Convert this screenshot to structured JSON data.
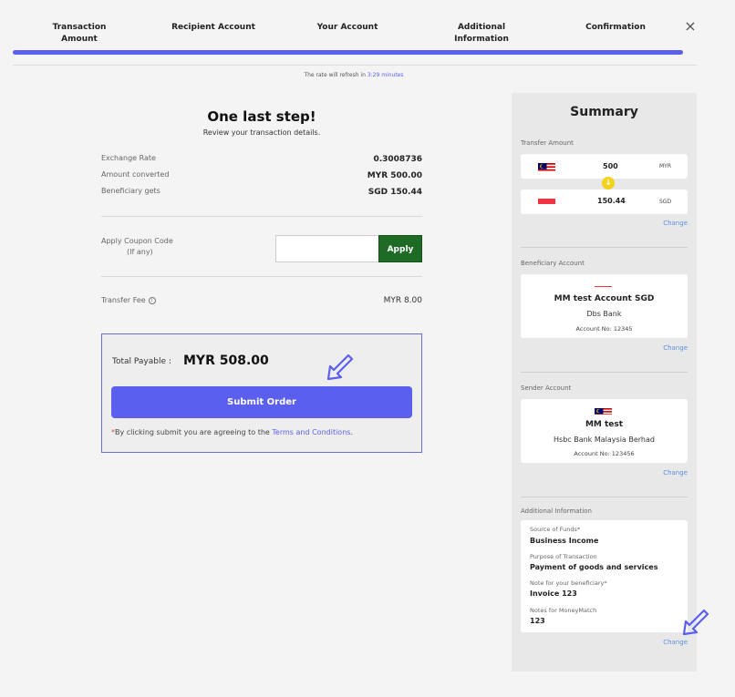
{
  "stepper": {
    "steps": [
      {
        "line1": "Transaction",
        "line2": "Amount"
      },
      {
        "line1": "Recipient Account",
        "line2": ""
      },
      {
        "line1": "Your Account",
        "line2": ""
      },
      {
        "line1": "Additional",
        "line2": "Information"
      },
      {
        "line1": "Confirmation",
        "line2": ""
      }
    ],
    "progress": 1.0,
    "close_icon": "×"
  },
  "refresh": {
    "prefix": "The rate will refresh in",
    "time": "3:29 minutes"
  },
  "main": {
    "title": "One last step!",
    "subtitle": "Review your transaction details.",
    "rows": [
      {
        "label": "Exchange Rate",
        "value": "0.3008736"
      },
      {
        "label": "Amount converted",
        "value": "MYR 500.00"
      },
      {
        "label": "Beneficiary gets",
        "value": "SGD 150.44"
      }
    ],
    "coupon": {
      "label": "Apply Coupon Code",
      "sublabel": "(If any)",
      "value": "",
      "button": "Apply"
    },
    "fee": {
      "label": "Transfer Fee",
      "icon": "info-icon",
      "value": "MYR 8.00"
    },
    "payable": {
      "label": "Total Payable :",
      "amount": "MYR 508.00"
    },
    "submit": "Submit Order",
    "terms": {
      "star": "*",
      "text": "By clicking submit you are agreeing to the",
      "link": "Terms and Conditions",
      "end": "."
    }
  },
  "summary": {
    "title": "Summary",
    "transfer": {
      "label": "Transfer Amount",
      "from": {
        "amount": "500",
        "currency": "MYR",
        "flag": "malaysia-flag"
      },
      "to": {
        "amount": "150.44",
        "currency": "SGD",
        "flag": "singapore-flag"
      },
      "change": "Change"
    },
    "beneficiary": {
      "label": "Beneficiary Account",
      "name": "MM test Account SGD",
      "bank": "Dbs Bank",
      "account": "Account No: 12345",
      "change": "Change"
    },
    "sender": {
      "label": "Sender Account",
      "name": "MM test",
      "bank": "Hsbc Bank Malaysia Berhad",
      "account": "Account No: 123456",
      "change": "Change"
    },
    "additional": {
      "label": "Additional Information",
      "items": [
        {
          "key": "Source of Funds*",
          "value": "Business Income"
        },
        {
          "key": "Purpose of Transaction",
          "value": "Payment of goods and services"
        },
        {
          "key": "Note for your beneficiary*",
          "value": "Invoice 123"
        },
        {
          "key": "Notes for MoneyMatch",
          "value": "123"
        }
      ],
      "change": "Change"
    }
  },
  "colors": {
    "accent": "#5b5fee",
    "apply": "#1d6b25",
    "link": "#5b8ee0"
  }
}
